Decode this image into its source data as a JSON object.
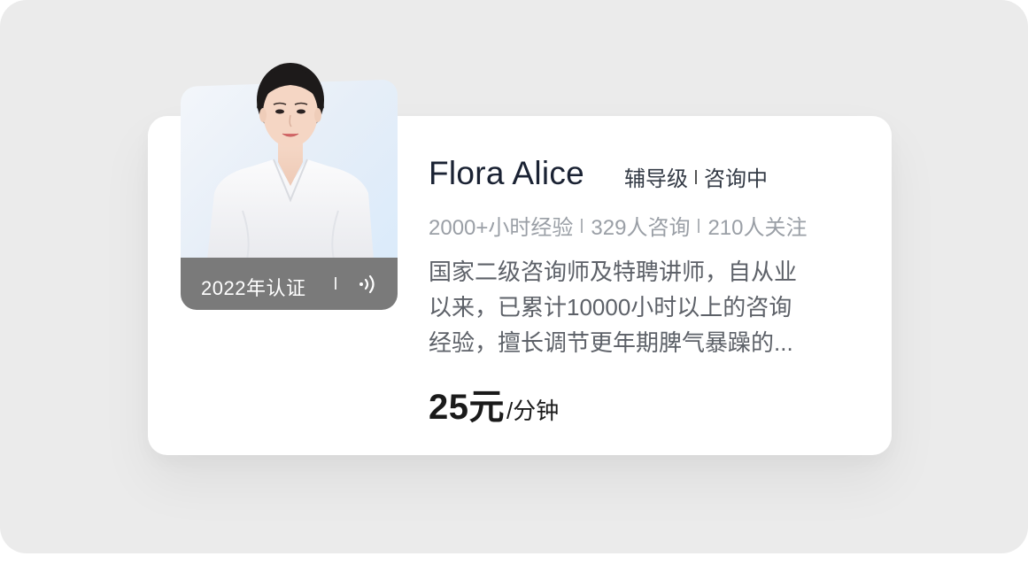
{
  "profile": {
    "name": "Flora Alice",
    "level": "辅导级",
    "status": "咨询中",
    "stats": [
      "2000+小时经验",
      "329人咨询",
      "210人关注"
    ],
    "description_lines": [
      "国家二级咨询师及特聘讲师，自从业",
      "以来，已累计10000小时以上的咨询",
      "经验，擅长调节更年期脾气暴躁的..."
    ],
    "price_value": "25元",
    "price_unit": "/分钟"
  },
  "avatar": {
    "certification": "2022年认证",
    "audio_icon": "audio-wave-icon"
  },
  "colors": {
    "background": "#ebebeb",
    "card": "#ffffff",
    "cert_bar": "#7a7a7a",
    "name": "#1a2233",
    "stats": "#9a9fa6",
    "description": "#5d6168"
  }
}
